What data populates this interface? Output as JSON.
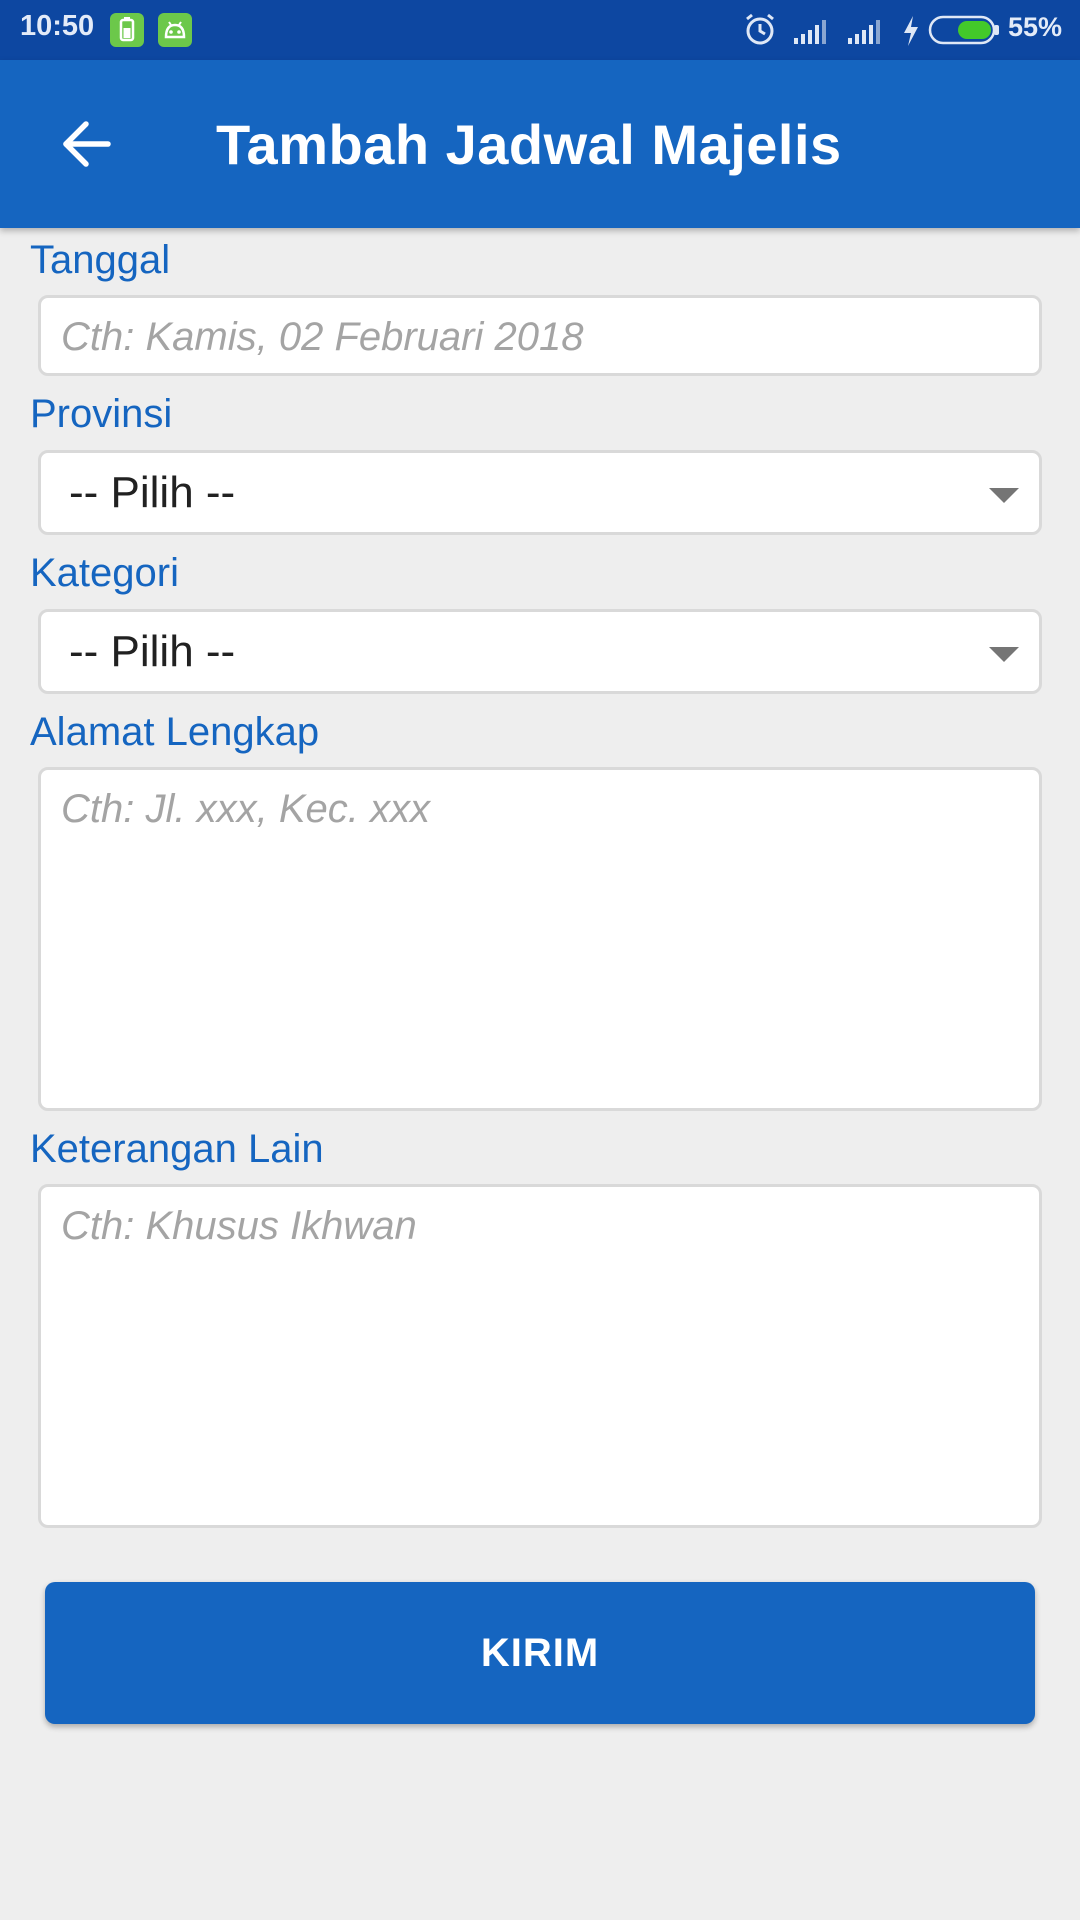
{
  "status_bar": {
    "time": "10:50",
    "battery_percent": "55%",
    "icons": [
      "battery-notification-icon",
      "android-notification-icon",
      "alarm-icon",
      "signal-icon",
      "signal-icon",
      "charging-icon",
      "battery-icon"
    ]
  },
  "app_bar": {
    "title": "Tambah Jadwal Majelis",
    "back_icon": "arrow-back-icon"
  },
  "form": {
    "tanggal": {
      "label": "Tanggal",
      "placeholder": "Cth: Kamis, 02 Februari 2018"
    },
    "provinsi": {
      "label": "Provinsi",
      "selected": "-- Pilih --"
    },
    "kategori": {
      "label": "Kategori",
      "selected": "-- Pilih --"
    },
    "alamat": {
      "label": "Alamat Lengkap",
      "placeholder": "Cth: Jl. xxx, Kec. xxx"
    },
    "keterangan": {
      "label": "Keterangan Lain",
      "placeholder": "Cth: Khusus Ikhwan"
    },
    "submit_label": "KIRIM"
  },
  "colors": {
    "status_bar": "#0d47a1",
    "primary": "#1565c0",
    "background": "#eeeeee",
    "placeholder": "#a4a4a4"
  }
}
